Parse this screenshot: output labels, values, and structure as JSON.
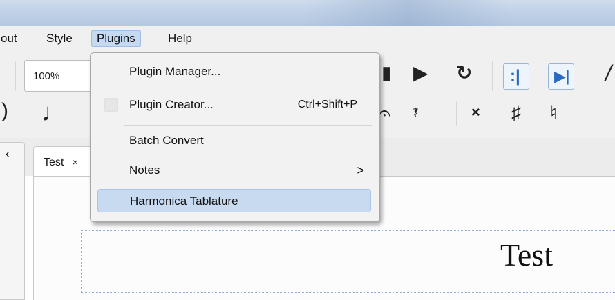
{
  "menubar": {
    "items": [
      {
        "label": "out"
      },
      {
        "label": "Style"
      },
      {
        "label": "Plugins"
      },
      {
        "label": "Help"
      }
    ]
  },
  "toolbar": {
    "zoom_value": "100%"
  },
  "tabs": {
    "score_tab_label": "Test",
    "score_tab_close": "×"
  },
  "plugins_menu": {
    "items": [
      {
        "label": "Plugin Manager...",
        "shortcut": ""
      },
      {
        "label": "Plugin Creator...",
        "shortcut": "Ctrl+Shift+P"
      },
      {
        "label": "Batch Convert",
        "shortcut": ""
      },
      {
        "label": "Notes",
        "submenu_arrow": ">"
      },
      {
        "label": "Harmonica Tablature",
        "shortcut": ""
      }
    ]
  },
  "score": {
    "title": "Test"
  },
  "colors": {
    "menu_highlight": "#c7daf0",
    "toolbar_bg": "#f0f0f0"
  }
}
